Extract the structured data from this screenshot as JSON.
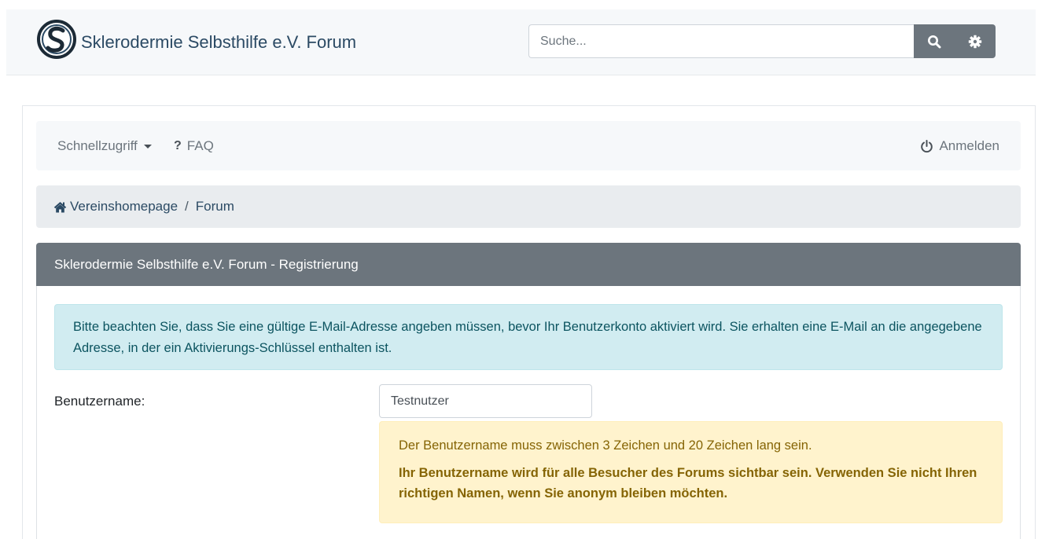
{
  "header": {
    "site_title": "Sklerodermie Selbsthilfe e.V. Forum",
    "logo_icon": "logo-s-icon",
    "search": {
      "placeholder": "Suche...",
      "value": ""
    },
    "search_button_icon": "search-icon",
    "settings_button_icon": "gear-icon"
  },
  "navbar": {
    "quick_access": "Schnellzugriff",
    "faq": "FAQ",
    "faq_symbol": "?",
    "login": "Anmelden"
  },
  "breadcrumb": {
    "items": [
      "Vereinshomepage",
      "Forum"
    ],
    "separator": "/"
  },
  "panel": {
    "title": "Sklerodermie Selbsthilfe e.V. Forum - Registrierung",
    "info_text": "Bitte beachten Sie, dass Sie eine gültige E-Mail-Adresse angeben müssen, bevor Ihr Benutzerkonto aktiviert wird. Sie erhalten eine E-Mail an die angegebene Adresse, in der ein Aktivierungs-Schlüssel enthalten ist.",
    "username_label": "Benutzername:",
    "username_value": "Testnutzer",
    "warning_line1": "Der Benutzername muss zwischen 3 Zeichen und 20 Zeichen lang sein.",
    "warning_line2": "Ihr Benutzername wird für alle Besucher des Forums sichtbar sein. Verwenden Sie nicht Ihren richtigen Namen, wenn Sie anonym bleiben möchten."
  },
  "colors": {
    "header_bg": "#f6f8fa",
    "title_text": "#2b4a64",
    "panel_header": "#6c757d",
    "info_bg": "#d1ecf1",
    "warning_bg": "#fff3cd"
  }
}
